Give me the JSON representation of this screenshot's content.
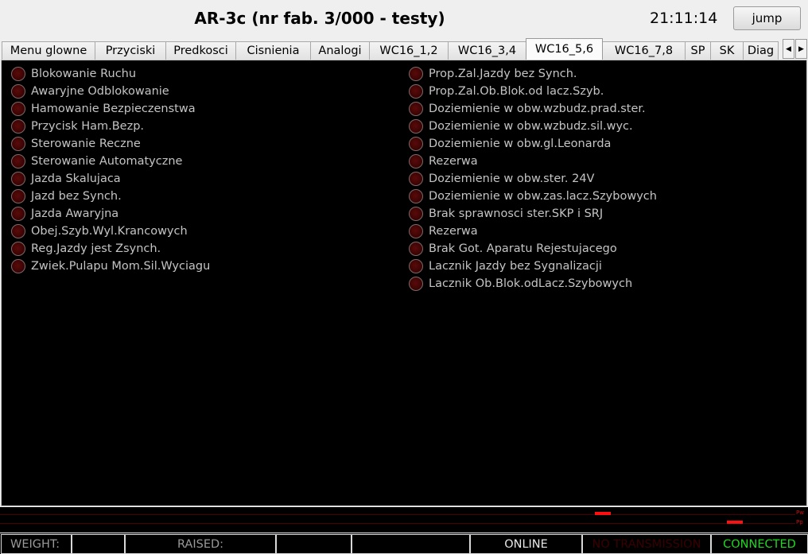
{
  "header": {
    "title": "AR-3c (nr fab. 3/000 - testy)",
    "clock": "21:11:14",
    "jump_label": "jump"
  },
  "tabs": [
    {
      "label": "Menu glowne",
      "active": false
    },
    {
      "label": "Przyciski",
      "active": false
    },
    {
      "label": "Predkosci",
      "active": false
    },
    {
      "label": "Cisnienia",
      "active": false
    },
    {
      "label": "Analogi",
      "active": false
    },
    {
      "label": "WC16_1,2",
      "active": false
    },
    {
      "label": "WC16_3,4",
      "active": false
    },
    {
      "label": "WC16_5,6",
      "active": true
    },
    {
      "label": "WC16_7,8",
      "active": false
    },
    {
      "label": "SP",
      "active": false
    },
    {
      "label": "SK",
      "active": false
    },
    {
      "label": "Diag",
      "active": false
    }
  ],
  "tab_scroll": {
    "left_icon": "arrow-left-icon",
    "right_icon": "arrow-right-icon"
  },
  "signals": {
    "left": [
      "Blokowanie Ruchu",
      "Awaryjne Odblokowanie",
      "Hamowanie Bezpieczenstwa",
      "Przycisk Ham.Bezp.",
      "Sterowanie Reczne",
      "Sterowanie Automatyczne",
      "Jazda Skalujaca",
      "Jazd bez Synch.",
      "Jazda Awaryjna",
      "Obej.Szyb.Wyl.Krancowych",
      "Reg.Jazdy jest Zsynch.",
      "Zwiek.Pulapu Mom.Sil.Wyciagu"
    ],
    "right": [
      "Prop.Zal.Jazdy bez Synch.",
      "Prop.Zal.Ob.Blok.od lacz.Szyb.",
      "Doziemienie w obw.wzbudz.prad.ster.",
      "Doziemienie w obw.wzbudz.sil.wyc.",
      "Doziemienie w obw.gl.Leonarda",
      "Rezerwa",
      "Doziemienie w obw.ster. 24V",
      "Doziemienie w obw.zas.lacz.Szybowych",
      "Brak sprawnosci ster.SKP i SRJ",
      "Rezerwa",
      "Brak Got. Aparatu Rejestujacego",
      "Lacznik Jazdy bez Sygnalizacji",
      "Lacznik Ob.Blok.odLacz.Szybowych"
    ],
    "led_state": "off",
    "led_color": "#3a0000"
  },
  "trend": {
    "labels": [
      "Pw",
      "Pp"
    ],
    "color": "#ff1010"
  },
  "status": {
    "weight_label": "WEIGHT:",
    "weight_value": "",
    "raised_label": "RAISED:",
    "raised_value": "",
    "empty_field": "",
    "online": "ONLINE",
    "no_transmission": "NO TRANSMISSION",
    "connected": "CONNECTED",
    "connected_color": "#1ed81e"
  }
}
